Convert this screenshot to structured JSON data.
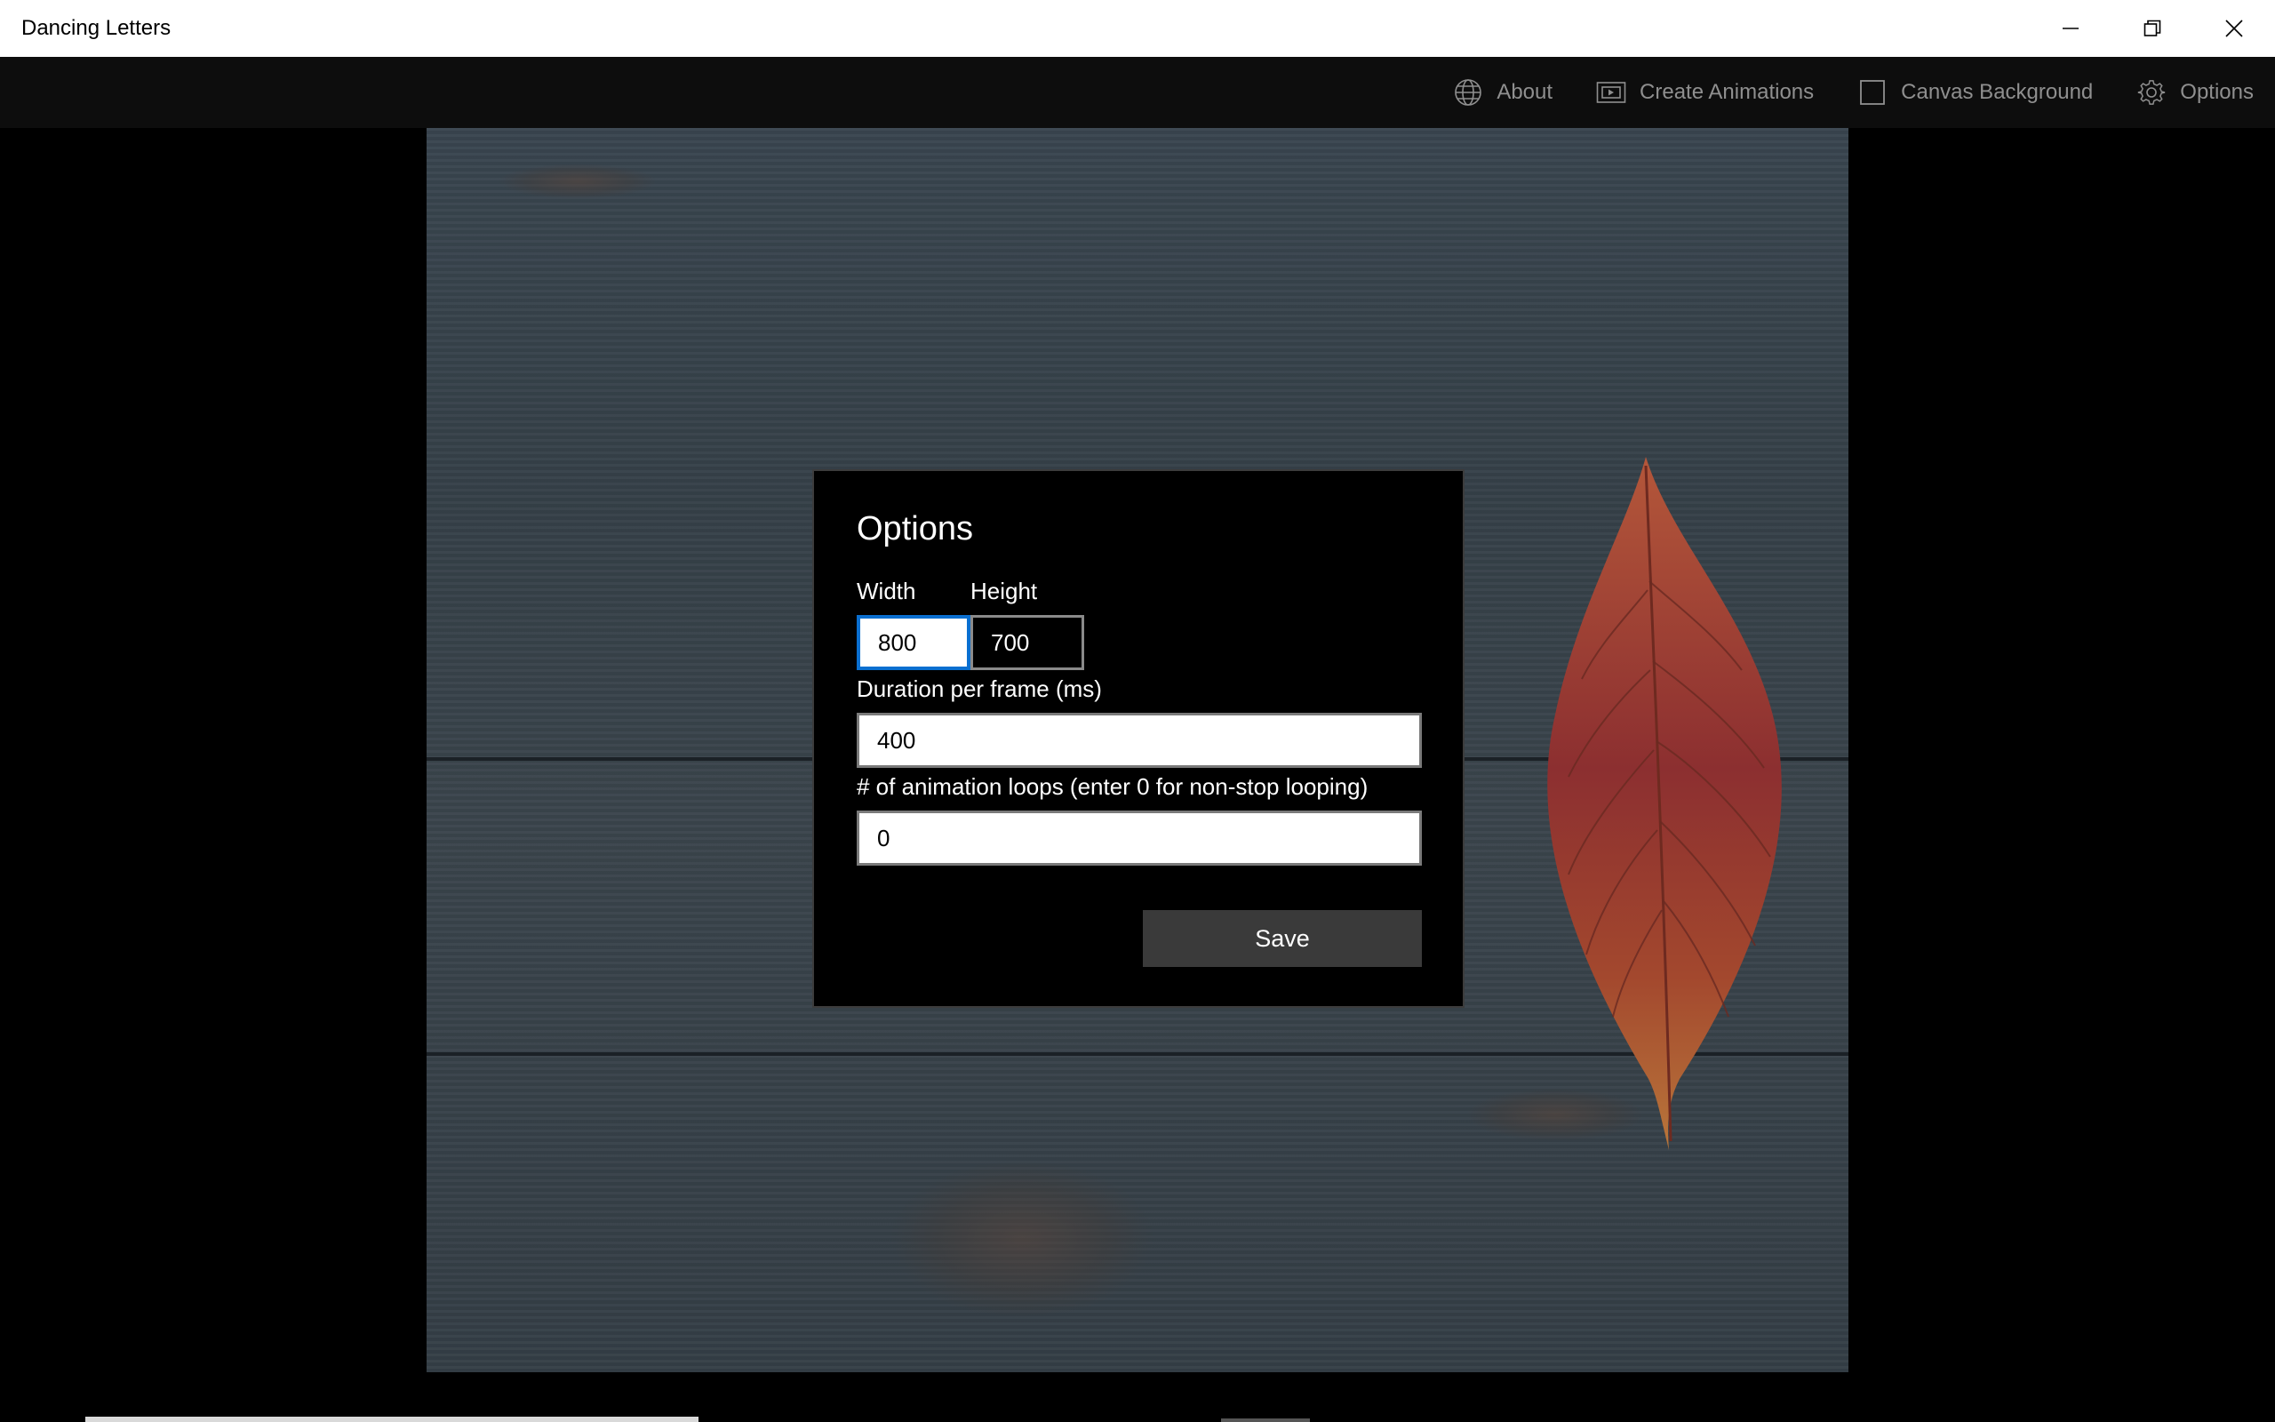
{
  "window": {
    "title": "Dancing Letters"
  },
  "commandbar": {
    "items": [
      {
        "label": "About",
        "icon": "globe-icon"
      },
      {
        "label": "Create Animations",
        "icon": "film-icon"
      },
      {
        "label": "Canvas Background",
        "icon": "checkbox-icon"
      },
      {
        "label": "Options",
        "icon": "gear-icon"
      }
    ]
  },
  "dialog": {
    "title": "Options",
    "width_label": "Width",
    "height_label": "Height",
    "width_value": "800",
    "height_value": "700",
    "duration_label": "Duration per frame (ms)",
    "duration_value": "400",
    "loops_label": "# of animation loops (enter 0 for non-stop looping)",
    "loops_value": "0",
    "save_label": "Save"
  },
  "colors": {
    "accent": "#0a6fd0",
    "titlebar": "#ffffff",
    "commandbar": "#0d0d0d",
    "dialog": "#000000"
  }
}
